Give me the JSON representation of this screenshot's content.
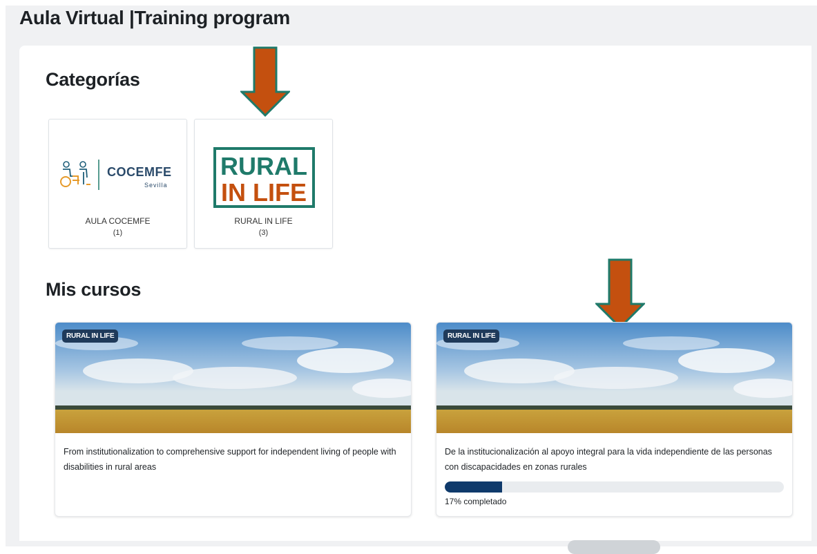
{
  "page": {
    "title": "Aula Virtual |Training program"
  },
  "categories": {
    "heading": "Categorías",
    "items": [
      {
        "name": "AULA COCEMFE",
        "count": "(1)",
        "logo_text": "COCEMFE",
        "logo_subtext": "Sevilla"
      },
      {
        "name": "RURAL IN LIFE",
        "count": "(3)",
        "logo_line1": "RURAL",
        "logo_line2": "IN LIFE"
      }
    ]
  },
  "courses": {
    "heading": "Mis cursos",
    "items": [
      {
        "badge": "RURAL IN LIFE",
        "title": "From institutionalization to comprehensive support for independent living of people with disabilities in rural areas"
      },
      {
        "badge": "RURAL IN LIFE",
        "title": "De la institucionalización al apoyo integral para la vida independiente de las personas con discapacidades en zonas rurales",
        "progress": 17,
        "progress_label": "17% completado"
      }
    ]
  },
  "colors": {
    "annotation_arrow_fill": "#c4500f",
    "annotation_arrow_border": "#1f7a6a",
    "rural_green": "#1f7a6a",
    "rural_orange": "#c4500f",
    "badge_bg": "#1f3a5a",
    "progress_fill": "#0f3a6b"
  },
  "icons": [
    "down-arrow-annotation-icon",
    "cocemfe-people-icon"
  ]
}
